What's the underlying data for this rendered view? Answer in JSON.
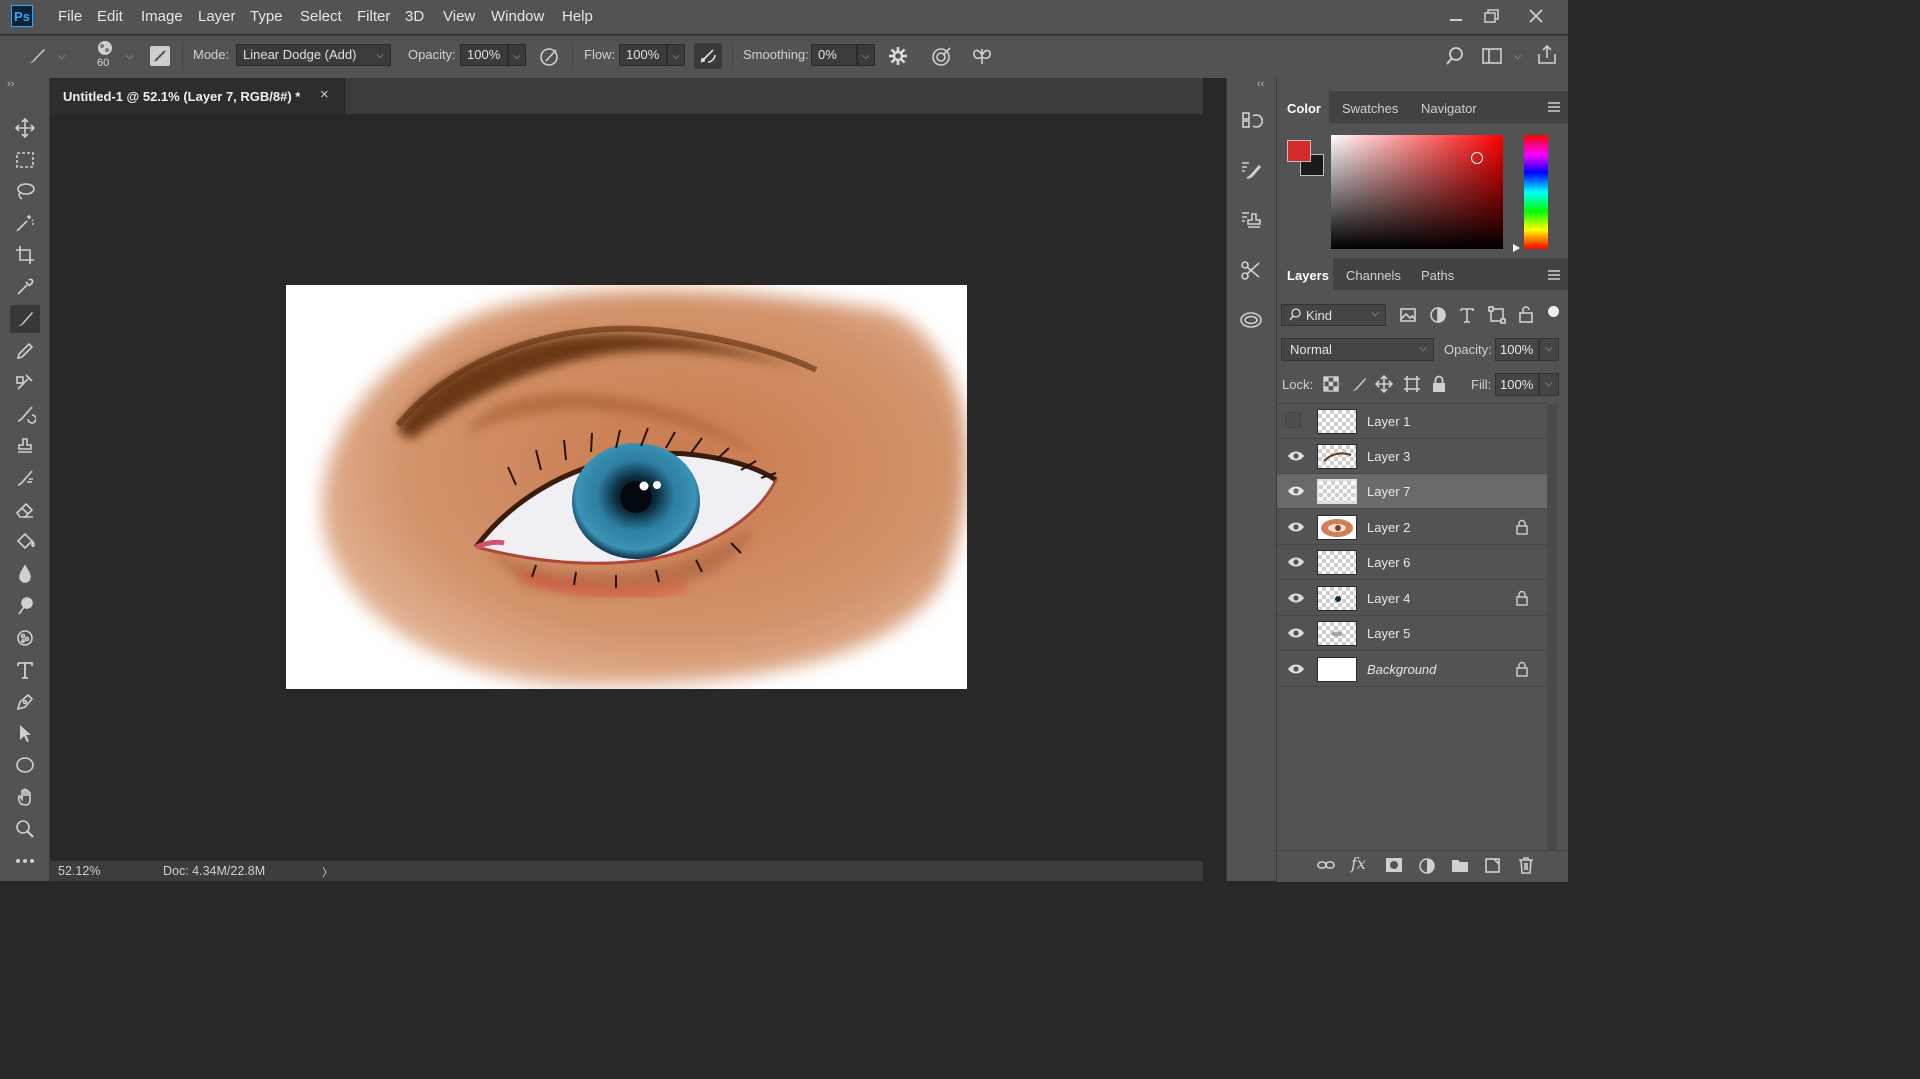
{
  "app": {
    "logo": "Ps"
  },
  "menu": [
    "File",
    "Edit",
    "Image",
    "Layer",
    "Type",
    "Select",
    "Filter",
    "3D",
    "View",
    "Window",
    "Help"
  ],
  "options": {
    "brush_size": "60",
    "mode_label": "Mode:",
    "mode_value": "Linear Dodge (Add)",
    "opacity_label": "Opacity:",
    "opacity_value": "100%",
    "flow_label": "Flow:",
    "flow_value": "100%",
    "smoothing_label": "Smoothing:",
    "smoothing_value": "0%"
  },
  "document": {
    "tab_title": "Untitled-1 @ 52.1% (Layer 7, RGB/8#) *",
    "close_glyph": "×",
    "zoom": "52.12%",
    "doc_info": "Doc: 4.34M/22.8M",
    "status_arrow": "〉"
  },
  "color_panel": {
    "tabs": [
      "Color",
      "Swatches",
      "Navigator"
    ],
    "foreground": "#d42a2a",
    "background": "#1a1a1a"
  },
  "layers_panel": {
    "tabs": [
      "Layers",
      "Channels",
      "Paths"
    ],
    "filter_kind": "Kind",
    "blend_mode": "Normal",
    "opacity_label": "Opacity:",
    "opacity_value": "100%",
    "lock_label": "Lock:",
    "fill_label": "Fill:",
    "fill_value": "100%",
    "layers": [
      {
        "name": "Layer 1",
        "visible": false,
        "locked": false,
        "selected": false
      },
      {
        "name": "Layer 3",
        "visible": true,
        "locked": false,
        "selected": false
      },
      {
        "name": "Layer 7",
        "visible": true,
        "locked": false,
        "selected": true
      },
      {
        "name": "Layer 2",
        "visible": true,
        "locked": true,
        "selected": false
      },
      {
        "name": "Layer 6",
        "visible": true,
        "locked": false,
        "selected": false
      },
      {
        "name": "Layer 4",
        "visible": true,
        "locked": true,
        "selected": false
      },
      {
        "name": "Layer 5",
        "visible": true,
        "locked": false,
        "selected": false
      },
      {
        "name": "Background",
        "visible": true,
        "locked": true,
        "selected": false
      }
    ]
  }
}
